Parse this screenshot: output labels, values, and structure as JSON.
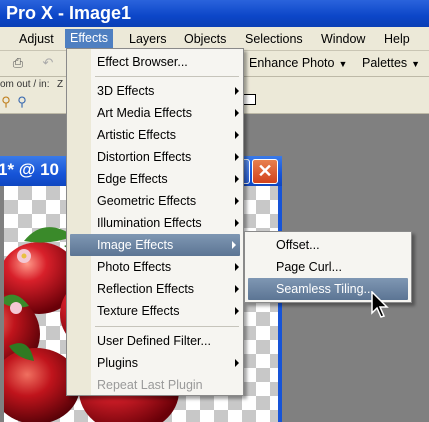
{
  "title": "Pro X - Image1",
  "menubar": [
    "Adjust",
    "Effects",
    "Layers",
    "Objects",
    "Selections",
    "Window",
    "Help"
  ],
  "toolbar": {
    "enhance_photo": "Enhance Photo",
    "palettes": "Palettes",
    "zoom_label": "om out / in:",
    "zoom_short": "Z"
  },
  "image_window": {
    "title": "1* @ 10"
  },
  "effects_menu": {
    "items": [
      "Effect Browser...",
      "3D Effects",
      "Art Media Effects",
      "Artistic Effects",
      "Distortion Effects",
      "Edge Effects",
      "Geometric Effects",
      "Illumination Effects",
      "Image Effects",
      "Photo Effects",
      "Reflection Effects",
      "Texture Effects",
      "User Defined Filter...",
      "Plugins",
      "Repeat Last Plugin"
    ],
    "highlighted": "Image Effects"
  },
  "image_effects_submenu": {
    "items": [
      "Offset...",
      "Page Curl...",
      "Seamless Tiling..."
    ],
    "highlighted": "Seamless Tiling..."
  },
  "colors": {
    "titlebar": "#0c46c8",
    "menu_highlight": "#5c7594",
    "menubar_active": "#4e7fc1",
    "apple_red": "#c8141c",
    "leaf_green": "#3a8a2a"
  }
}
